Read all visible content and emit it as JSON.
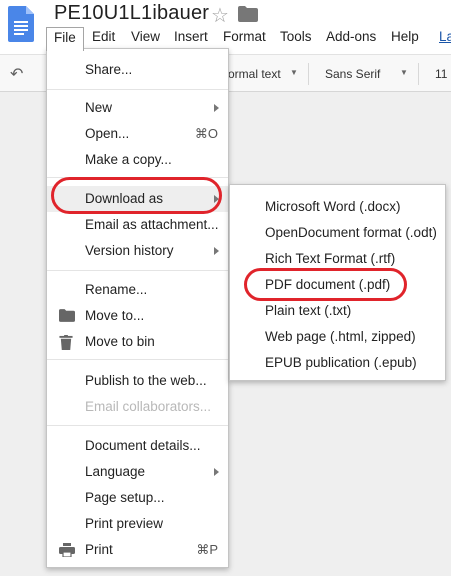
{
  "document": {
    "title": "PE10U1L1ibauer"
  },
  "menubar": {
    "items": [
      "File",
      "Edit",
      "View",
      "Insert",
      "Format",
      "Tools",
      "Add-ons",
      "Help"
    ],
    "last_edit_link": "La"
  },
  "toolbar": {
    "style": "ormal text",
    "font": "Sans Serif",
    "size": "11"
  },
  "file_menu": {
    "share": "Share...",
    "new": "New",
    "open": "Open...",
    "open_shortcut": "⌘O",
    "make_copy": "Make a copy...",
    "download_as": "Download as",
    "email_attachment": "Email as attachment...",
    "version_history": "Version history",
    "rename": "Rename...",
    "move_to": "Move to...",
    "move_to_bin": "Move to bin",
    "publish": "Publish to the web...",
    "email_collaborators": "Email collaborators...",
    "document_details": "Document details...",
    "language": "Language",
    "page_setup": "Page setup...",
    "print_preview": "Print preview",
    "print": "Print",
    "print_shortcut": "⌘P"
  },
  "download_submenu": {
    "items": [
      "Microsoft Word (.docx)",
      "OpenDocument format (.odt)",
      "Rich Text Format (.rtf)",
      "PDF document (.pdf)",
      "Plain text (.txt)",
      "Web page (.html, zipped)",
      "EPUB publication (.epub)"
    ]
  },
  "colors": {
    "docs_blue": "#4a86e8",
    "highlight_ring": "#e0242b",
    "link": "#1a55a8"
  }
}
